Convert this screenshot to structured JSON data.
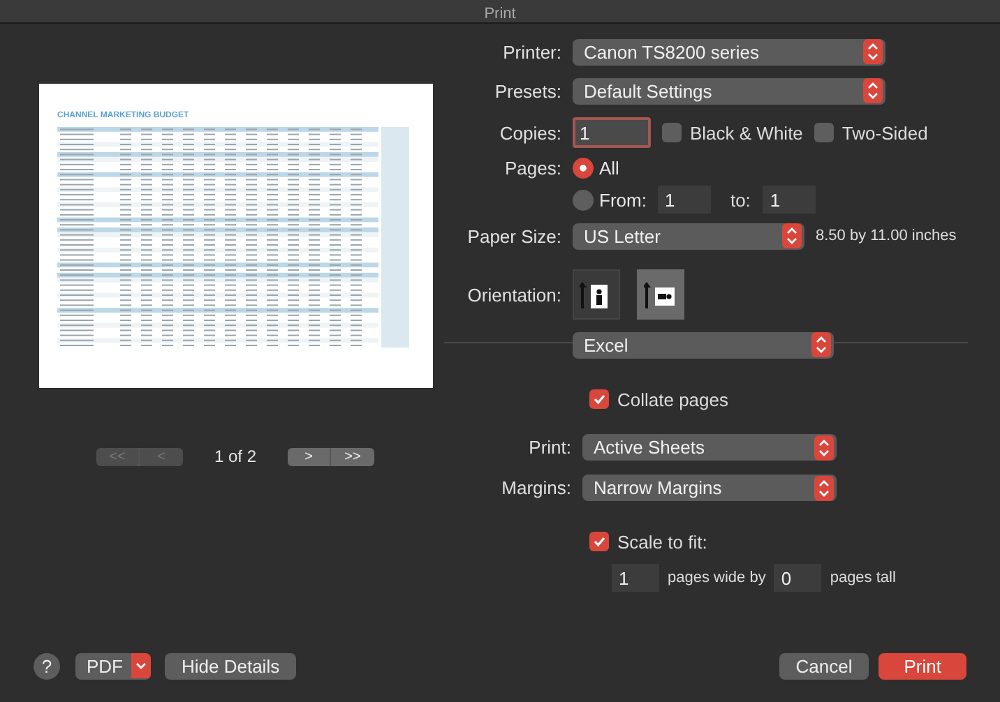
{
  "window": {
    "title": "Print"
  },
  "preview": {
    "document_title": "CHANNEL MARKETING BUDGET"
  },
  "navigation": {
    "buttons": [
      {
        "text": "<<",
        "disabled": true
      },
      {
        "text": "<",
        "disabled": true
      },
      {
        "text": ">",
        "disabled": false
      },
      {
        "text": ">>",
        "disabled": false
      }
    ],
    "page_indicator": "1 of 2"
  },
  "printer": {
    "label": "Printer:",
    "value": "Canon TS8200 series"
  },
  "presets": {
    "label": "Presets:",
    "value": "Default Settings"
  },
  "copies": {
    "label": "Copies:",
    "value": "1"
  },
  "black_and_white": {
    "label": "Black & White",
    "checked": false
  },
  "two_sided": {
    "label": "Two-Sided",
    "checked": false
  },
  "pages": {
    "label": "Pages:",
    "options": [
      {
        "label": "All",
        "selected": true
      },
      {
        "label": "From:",
        "selected": false
      }
    ],
    "from": "1",
    "to_label": "to:",
    "to": "1"
  },
  "paper_size": {
    "label": "Paper Size:",
    "value": "US Letter",
    "dimensions": "8.50 by 11.00 inches"
  },
  "orientation": {
    "label": "Orientation:",
    "options": [
      {
        "kind": "portrait",
        "selected": false
      },
      {
        "kind": "landscape",
        "selected": true
      }
    ]
  },
  "section_menu": {
    "value": "Excel"
  },
  "collate": {
    "label": "Collate pages",
    "checked": true
  },
  "print_what": {
    "label": "Print:",
    "value": "Active Sheets"
  },
  "margins": {
    "label": "Margins:",
    "value": "Narrow Margins"
  },
  "scale_to_fit": {
    "label": "Scale to fit:",
    "checked": true,
    "pages_wide": "1",
    "pages_wide_label": "pages wide by",
    "pages_tall": "0",
    "pages_tall_label": "pages tall"
  },
  "footer": {
    "help": "?",
    "pdf": "PDF",
    "hide_details": "Hide Details",
    "cancel": "Cancel",
    "print": "Print"
  }
}
